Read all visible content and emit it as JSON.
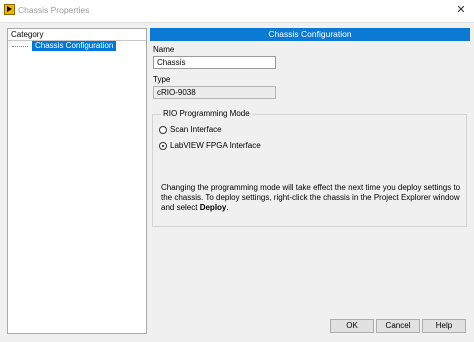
{
  "window": {
    "title": "Chassis Properties",
    "close_glyph": "✕",
    "app_icon": "labview-icon"
  },
  "category": {
    "header": "Category",
    "items": [
      {
        "label": "Chassis Configuration",
        "selected": true
      }
    ]
  },
  "main": {
    "section_title": "Chassis Configuration",
    "name_label": "Name",
    "name_value": "Chassis",
    "type_label": "Type",
    "type_value": "cRIO-9038",
    "mode_group": {
      "legend": "RIO Programming Mode",
      "options": [
        {
          "label": "Scan Interface",
          "selected": false
        },
        {
          "label": "LabVIEW FPGA Interface",
          "selected": true
        }
      ],
      "info_prefix": "Changing the programming mode will take effect the next time you deploy settings to the chassis. To deploy settings, right-click the chassis in the Project Explorer window and select ",
      "info_bold": "Deploy",
      "info_suffix": "."
    }
  },
  "buttons": {
    "ok": "OK",
    "cancel": "Cancel",
    "help": "Help"
  },
  "colors": {
    "header_blue": "#0a7ad5",
    "selection_blue": "#0078d7"
  }
}
